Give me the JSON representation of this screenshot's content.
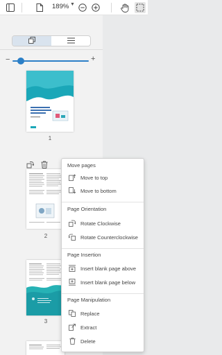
{
  "toolbar": {
    "zoom_value": "189%",
    "icons": [
      "sidebar-toggle-icon",
      "file-icon",
      "zoom-out-icon",
      "zoom-in-icon",
      "hand-icon",
      "selection-icon"
    ]
  },
  "panel": {
    "view_modes": [
      "thumbnail-view",
      "list-view"
    ],
    "active_view": "thumbnail-view",
    "slider_level_percent": 15
  },
  "pages": [
    {
      "number": "1",
      "title_lines": "Document title placeholder"
    },
    {
      "number": "2"
    },
    {
      "number": "3"
    }
  ],
  "menu": {
    "sections": [
      {
        "title": "Move pages",
        "items": [
          "Move to top",
          "Move to bottom"
        ]
      },
      {
        "title": "Page Orientation",
        "items": [
          "Rotate Clockwise",
          "Rotate Counterclockwise"
        ]
      },
      {
        "title": "Page Insertion",
        "items": [
          "Insert blank page above",
          "Insert blank page below"
        ]
      },
      {
        "title": "Page Manipulation",
        "items": [
          "Replace",
          "Extract",
          "Delete"
        ]
      }
    ]
  },
  "colors": {
    "accent": "#2b7fc7",
    "page1_wave": "#1aa7b8",
    "page3_wave": "#26b2b5"
  }
}
